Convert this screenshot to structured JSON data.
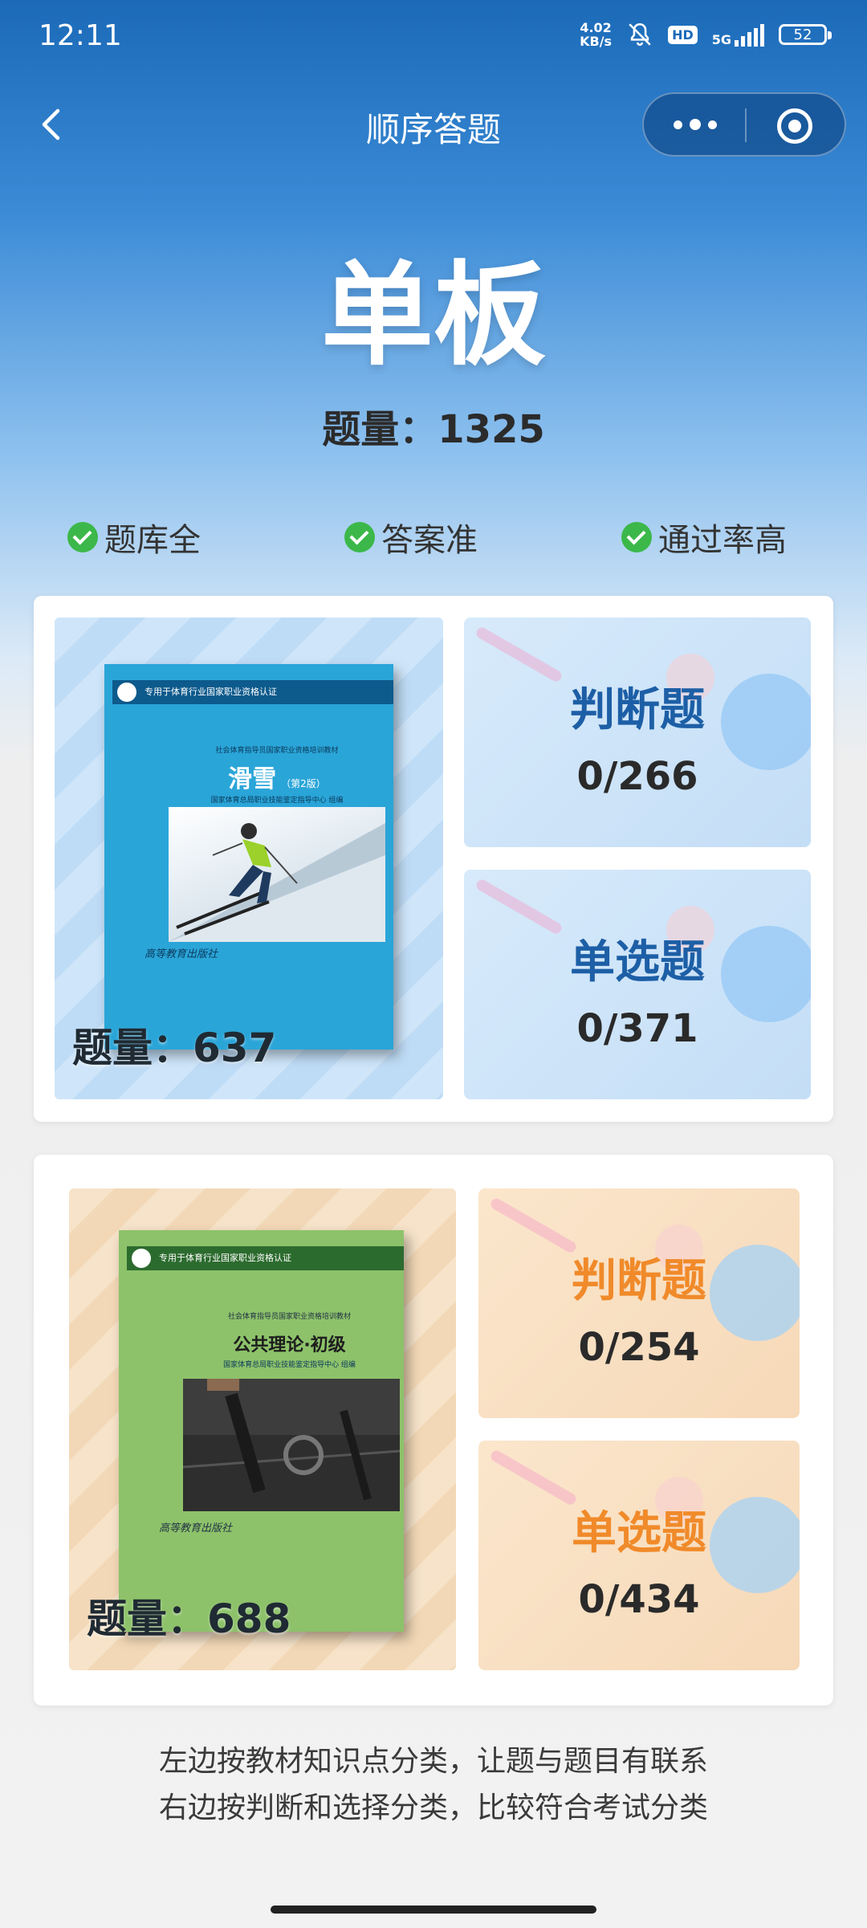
{
  "status_bar": {
    "time": "12:11",
    "net_speed_value": "4.02",
    "net_speed_unit": "KB/s",
    "hd": "HD",
    "network": "5G",
    "battery": "52"
  },
  "nav": {
    "title": "顺序答题"
  },
  "subject": {
    "title": "单板",
    "total": "题量：1325"
  },
  "features": [
    "题库全",
    "答案准",
    "通过率高"
  ],
  "sections": [
    {
      "book_header": "专用于体育行业国家职业资格认证",
      "book_series": "社会体育指导员国家职业资格培训教材",
      "book_name": "滑雪",
      "book_edition": "（第2版）",
      "book_org": "国家体育总局职业技能鉴定指导中心  组编",
      "book_publisher": "高等教育出版社",
      "count": "题量：637",
      "types": [
        {
          "label": "判断题",
          "progress": "0/266"
        },
        {
          "label": "单选题",
          "progress": "0/371"
        }
      ]
    },
    {
      "book_header": "专用于体育行业国家职业资格认证",
      "book_series": "社会体育指导员国家职业资格培训教材",
      "book_name": "公共理论·初级",
      "book_edition": "",
      "book_org": "国家体育总局职业技能鉴定指导中心  组编",
      "book_publisher": "高等教育出版社",
      "count": "题量：688",
      "types": [
        {
          "label": "判断题",
          "progress": "0/254"
        },
        {
          "label": "单选题",
          "progress": "0/434"
        }
      ]
    }
  ],
  "footer": {
    "line1": "左边按教材知识点分类，让题与题目有联系",
    "line2": "右边按判断和选择分类，比较符合考试分类"
  },
  "colors": {
    "header_blue": "#1b6ab8",
    "check_green": "#3cb84a",
    "blue_label": "#1d5fa6",
    "orange_label": "#f08a2a"
  }
}
